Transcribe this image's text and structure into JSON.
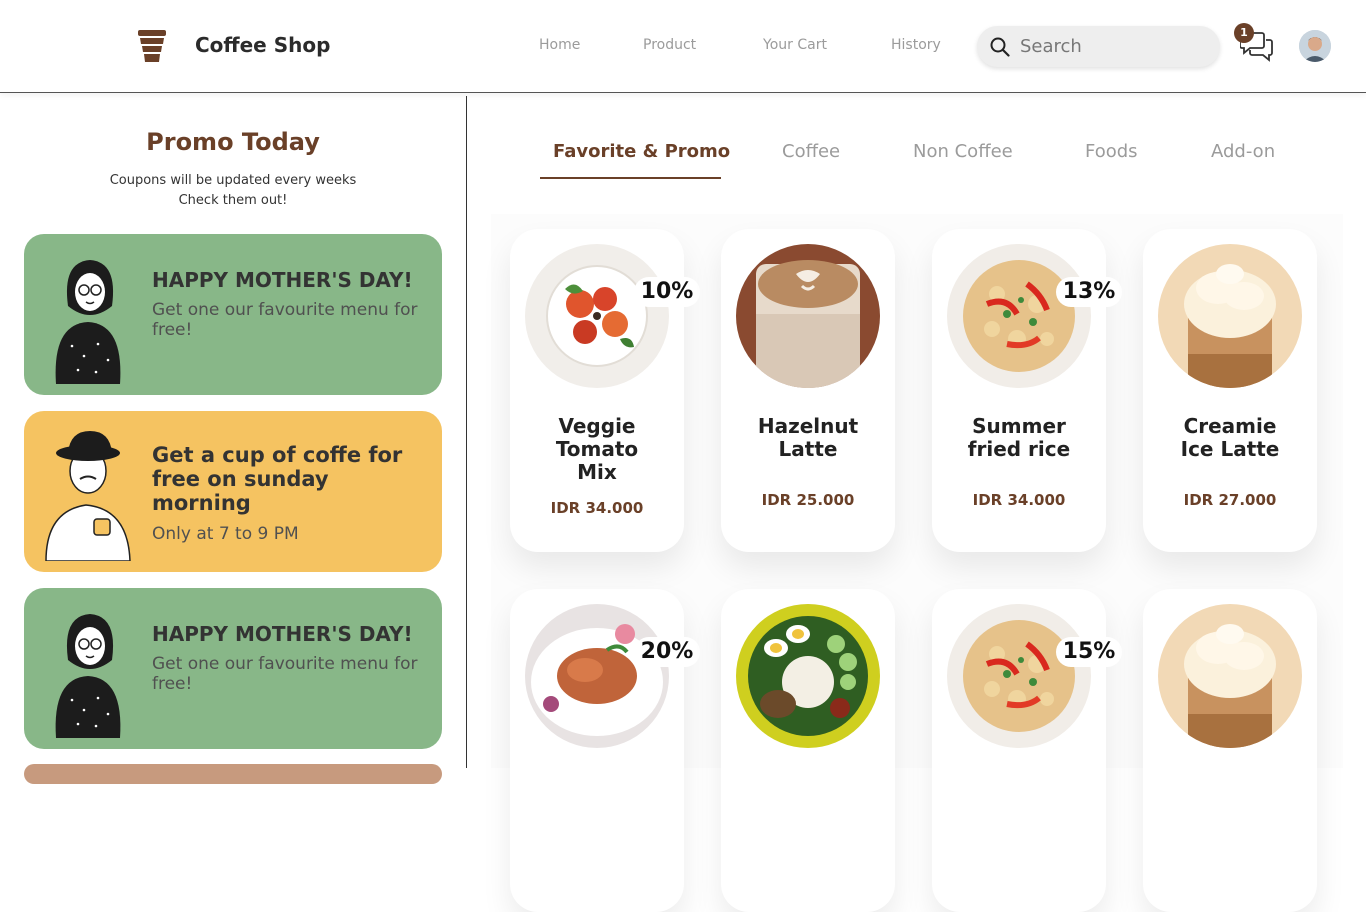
{
  "header": {
    "brand": "Coffee Shop",
    "nav": [
      "Home",
      "Product",
      "Your Cart",
      "History"
    ],
    "search_placeholder": "Search",
    "chat_badge": "1"
  },
  "promo": {
    "title": "Promo Today",
    "subtitle_line1": "Coupons will be updated every weeks",
    "subtitle_line2": "Check them out!",
    "coupons": [
      {
        "title": "HAPPY MOTHER'S DAY!",
        "desc": "Get one our favourite menu for free!",
        "color": "#88b788"
      },
      {
        "title": "Get a cup of coffe for free on sunday morning",
        "desc": "Only at 7 to 9 PM",
        "color": "#f5c361"
      },
      {
        "title": "HAPPY MOTHER'S DAY!",
        "desc": "Get one our favourite menu for free!",
        "color": "#88b788"
      }
    ]
  },
  "tabs": [
    "Favorite & Promo",
    "Coffee",
    "Non Coffee",
    "Foods",
    "Add-on"
  ],
  "products": [
    {
      "name": "Veggie Tomato Mix",
      "price": "IDR 34.000",
      "discount": "10%",
      "image": "veggie-salad"
    },
    {
      "name": "Hazelnut Latte",
      "price": "IDR 25.000",
      "discount": "",
      "image": "latte"
    },
    {
      "name": "Summer fried rice",
      "price": "IDR 34.000",
      "discount": "13%",
      "image": "fried-rice"
    },
    {
      "name": "Creamie Ice Latte",
      "price": "IDR 27.000",
      "discount": "",
      "image": "ice-latte"
    },
    {
      "name": "",
      "price": "",
      "discount": "20%",
      "image": "chicken"
    },
    {
      "name": "",
      "price": "",
      "discount": "",
      "image": "nasi-lemak"
    },
    {
      "name": "",
      "price": "",
      "discount": "15%",
      "image": "fried-rice"
    },
    {
      "name": "",
      "price": "",
      "discount": "",
      "image": "ice-latte"
    }
  ],
  "colors": {
    "brand": "#6a4028",
    "green_card": "#88b788",
    "yellow_card": "#f5c361"
  }
}
